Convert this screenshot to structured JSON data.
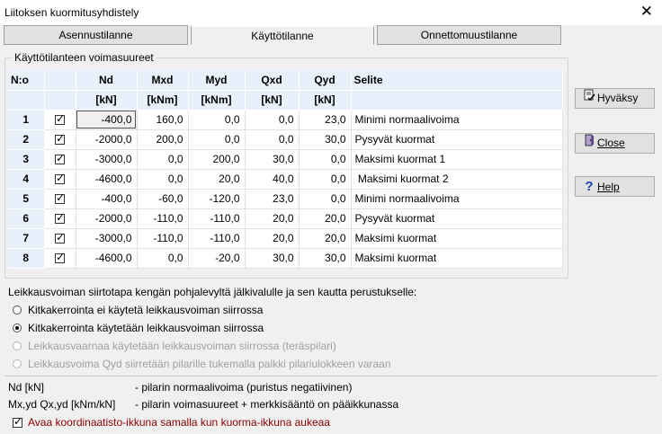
{
  "window": {
    "title": "Liitoksen kuormitusyhdistely",
    "close_glyph": "✕"
  },
  "tabs": [
    {
      "label": "Asennustilanne",
      "active": false
    },
    {
      "label": "Käyttötilanne",
      "active": true
    },
    {
      "label": "Onnettomuustilanne",
      "active": false
    }
  ],
  "group": {
    "legend": "Käyttötilanteen voimasuureet"
  },
  "table": {
    "headers": [
      "N:o",
      "",
      "Nd",
      "Mxd",
      "Myd",
      "Qxd",
      "Qyd",
      "Selite"
    ],
    "units": [
      "",
      "",
      "[kN]",
      "[kNm]",
      "[kNm]",
      "[kN]",
      "[kN]",
      ""
    ],
    "rows": [
      {
        "n": "1",
        "checked": true,
        "nd": "-400,0",
        "mxd": "160,0",
        "myd": "0,0",
        "qxd": "0,0",
        "qyd": "23,0",
        "desc": "Minimi normaalivoima"
      },
      {
        "n": "2",
        "checked": true,
        "nd": "-2000,0",
        "mxd": "200,0",
        "myd": "0,0",
        "qxd": "0,0",
        "qyd": "30,0",
        "desc": "Pysyvät kuormat"
      },
      {
        "n": "3",
        "checked": true,
        "nd": "-3000,0",
        "mxd": "0,0",
        "myd": "200,0",
        "qxd": "30,0",
        "qyd": "0,0",
        "desc": "Maksimi kuormat 1"
      },
      {
        "n": "4",
        "checked": true,
        "nd": "-4600,0",
        "mxd": "0,0",
        "myd": "20,0",
        "qxd": "40,0",
        "qyd": "0,0",
        "desc": " Maksimi kuormat 2"
      },
      {
        "n": "5",
        "checked": true,
        "nd": "-400,0",
        "mxd": "-60,0",
        "myd": "-120,0",
        "qxd": "23,0",
        "qyd": "0,0",
        "desc": "Minimi normaalivoima"
      },
      {
        "n": "6",
        "checked": true,
        "nd": "-2000,0",
        "mxd": "-110,0",
        "myd": "-110,0",
        "qxd": "20,0",
        "qyd": "20,0",
        "desc": "Pysyvät kuormat"
      },
      {
        "n": "7",
        "checked": true,
        "nd": "-3000,0",
        "mxd": "-110,0",
        "myd": "-110,0",
        "qxd": "20,0",
        "qyd": "20,0",
        "desc": "Maksimi kuormat"
      },
      {
        "n": "8",
        "checked": true,
        "nd": "-4600,0",
        "mxd": "0,0",
        "myd": "-20,0",
        "qxd": "30,0",
        "qyd": "30,0",
        "desc": "Maksimi kuormat"
      }
    ]
  },
  "buttons": {
    "accept": {
      "label": "Hyväksy",
      "icon": "accept-icon"
    },
    "close": {
      "label": "Close",
      "icon": "close-door-icon"
    },
    "help": {
      "label": "Help",
      "icon": "help-icon"
    }
  },
  "transfer": {
    "heading": "Leikkausvoiman siirtotapa kengän pohjalevyltä jälkivalulle ja sen kautta perustukselle:",
    "options": [
      {
        "label": "Kitkakerrointa ei käytetä leikkausvoiman siirrossa",
        "selected": false,
        "enabled": true
      },
      {
        "label": "Kitkakerrointa käytetään leikkausvoiman siirrossa",
        "selected": true,
        "enabled": true
      },
      {
        "label": "Leikkausvaarnaa käytetään leikkausvoiman siirrossa (teräspilari)",
        "selected": false,
        "enabled": false
      },
      {
        "label": "Leikkausvoima Qyd siirretään pilarille tukemalla palkki pilariulokkeen varaan",
        "selected": false,
        "enabled": false
      }
    ]
  },
  "legend_notes": [
    {
      "key": "Nd [kN]",
      "text": "- pilarin normaalivoima (puristus negatiivinen)"
    },
    {
      "key": "Mx,yd Qx,yd [kNm/kN]",
      "text": "- pilarin voimasuureet + merkkisääntö on pääikkunassa"
    }
  ],
  "open_coords": {
    "label": "Avaa koordinaatisto-ikkuna samalla kun kuorma-ikkuna aukeaa",
    "checked": true
  },
  "colors": {
    "header_bg": "#e8f1fb",
    "window_bg": "#f0f0f0",
    "note_red": "#8b0000"
  }
}
